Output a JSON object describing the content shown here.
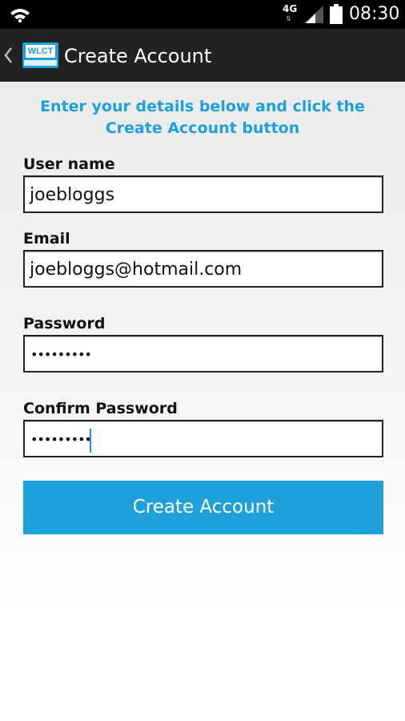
{
  "status_bar": {
    "network_type": "4G",
    "network_arrows": "⇅",
    "time": "08:30"
  },
  "action_bar": {
    "logo_text": "WLCT",
    "title": "Create Account"
  },
  "form": {
    "instructions": "Enter your details below and click the Create Account button",
    "username": {
      "label": "User name",
      "value": "joebloggs"
    },
    "email": {
      "label": "Email",
      "value": "joebloggs@hotmail.com"
    },
    "password": {
      "label": "Password",
      "value": "•••••••••"
    },
    "confirm_password": {
      "label": "Confirm Password",
      "value": "•••••••••"
    },
    "submit_label": "Create Account"
  },
  "colors": {
    "accent": "#1ea0db",
    "action_bar": "#222222",
    "status_bar": "#000000"
  }
}
